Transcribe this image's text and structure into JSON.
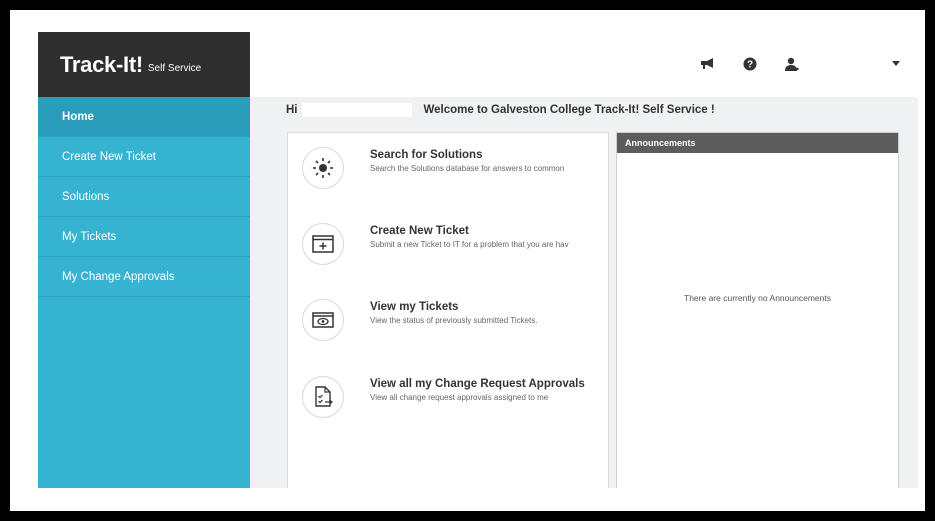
{
  "brand": {
    "logo": "Track-It!",
    "sub": "Self Service"
  },
  "header": {
    "icons": [
      "megaphone-icon",
      "help-icon",
      "user-icon",
      "dropdown-caret-icon"
    ]
  },
  "sidebar": {
    "items": [
      {
        "label": "Home",
        "active": true
      },
      {
        "label": "Create New Ticket"
      },
      {
        "label": "Solutions"
      },
      {
        "label": "My Tickets"
      },
      {
        "label": "My Change Approvals"
      }
    ]
  },
  "main": {
    "greeting_prefix": "Hi",
    "greeting_text": "Welcome to Galveston College Track-It! Self Service !",
    "cards": [
      {
        "icon": "lightbulb-icon",
        "title": "Search for Solutions",
        "desc": "Search the Solutions database for answers to common"
      },
      {
        "icon": "new-ticket-icon",
        "title": "Create New Ticket",
        "desc": "Submit a new Ticket to IT for a problem that you are hav"
      },
      {
        "icon": "eye-icon",
        "title": "View my Tickets",
        "desc": "View the status of previously submitted Tickets."
      },
      {
        "icon": "approval-checklist-icon",
        "title": "View all my Change Request Approvals",
        "desc": "View all change request approvals assigned to me"
      }
    ]
  },
  "announcements": {
    "title": "Announcements",
    "empty_text": "There are currently no Announcements"
  },
  "colors": {
    "sidebar": "#37b3d2",
    "sidebar_active": "#2a9dba",
    "brand_bg": "#2e2e2e",
    "announcements_header": "#5c5c5c"
  }
}
